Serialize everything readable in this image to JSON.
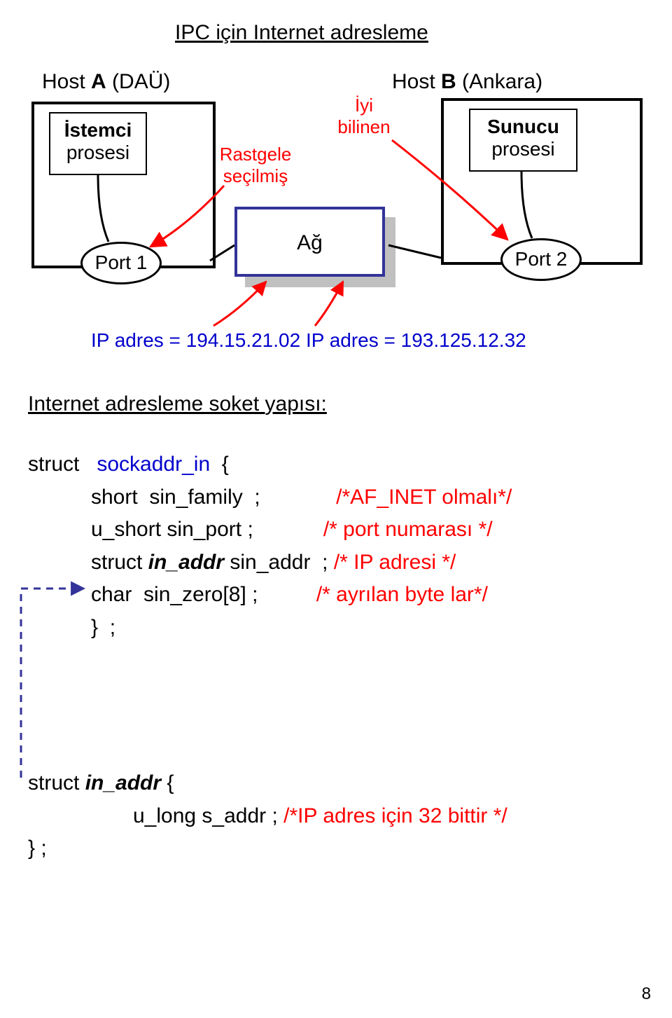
{
  "title": "IPC için Internet adresleme",
  "hostA": {
    "label_pre": "Host ",
    "label_bold": "A",
    "label_post": " (DAÜ)"
  },
  "hostB": {
    "label_pre": "Host ",
    "label_bold": "B",
    "label_post": " (Ankara)"
  },
  "client": {
    "line1_bold": "İstemci",
    "line2": "prosesi"
  },
  "server": {
    "line1_bold": "Sunucu",
    "line2": "prosesi"
  },
  "port1": "Port 1",
  "port2": "Port 2",
  "rastgele": {
    "l1": "Rastgele",
    "l2": "seçilmiş"
  },
  "iyi": {
    "l1": "İyi",
    "l2": "bilinen"
  },
  "network": "Ağ",
  "ipline_pre": "IP adres = ",
  "ipline_ip1": "194.15.21.02",
  "ipline_mid": " IP adres = ",
  "ipline_ip2": "193.125.12.32",
  "subheading_pre": "Internet adresleme soket ",
  "subheading_post": "yapısı:",
  "struct1": {
    "open_pre": "struct   ",
    "open_type": "sockaddr_in",
    "open_post": "  {",
    "l1_pre": "short  sin_family  ;",
    "l1_cmt": "/*AF_INET olmalı*/",
    "l2_pre": "u_short sin_port ;",
    "l2_cmt": "/* port numarası */",
    "l3_pre": "struct ",
    "l3_ital": "in_addr",
    "l3_post": " sin_addr  ; ",
    "l3_cmt": "/* IP adresi */",
    "l4_pre": "char  sin_zero[8] ;",
    "l4_cmt": "/* ayrılan byte lar*/",
    "close": "}  ;"
  },
  "struct2": {
    "open_pre": "struct ",
    "open_ital": "in_addr",
    "open_post": " {",
    "l1_pre": "u_long  s_addr ;",
    "l1_cmt": "/*IP adres için 32 bittir */",
    "close": "}  ;"
  },
  "pagenum": "8"
}
